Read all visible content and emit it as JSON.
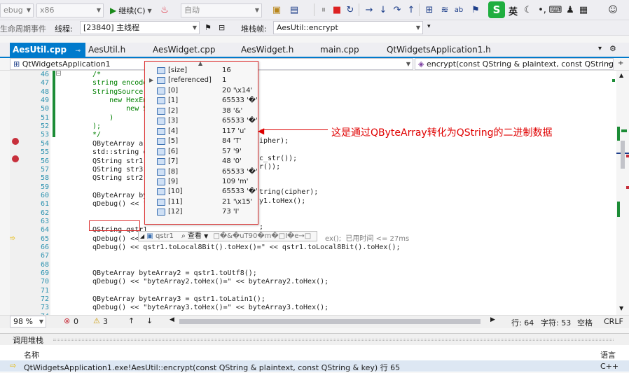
{
  "toolbar": {
    "config_combo": "ebug",
    "platform_combo": "x86",
    "continue_label": "继续(C)",
    "auto_combo": "自动",
    "ime_label": "英"
  },
  "toolbar2": {
    "lifecycle_label": "生命周期事件",
    "thread_label": "线程:",
    "thread_value": "[23840] 主线程",
    "stackframe_label": "堆栈帧:",
    "stackframe_value": "AesUtil::encrypt"
  },
  "tabs": [
    {
      "label": "AesUtil.cpp",
      "active": true
    },
    {
      "label": "AesUtil.h"
    },
    {
      "label": "AesWidget.cpp"
    },
    {
      "label": "AesWidget.h"
    },
    {
      "label": "main.cpp"
    },
    {
      "label": "QtWidgetsApplication1.h"
    }
  ],
  "navbar": {
    "project": "QtWidgetsApplication1",
    "function": "encrypt(const QString & plaintext, const QString"
  },
  "lines": [
    {
      "n": "46",
      "t": "/*"
    },
    {
      "n": "47",
      "t": "string encoded"
    },
    {
      "n": "48",
      "t": "StringSource(c"
    },
    {
      "n": "49",
      "t": "    new HexEnc"
    },
    {
      "n": "50",
      "t": "        new St"
    },
    {
      "n": "51",
      "t": "    )"
    },
    {
      "n": "52",
      "t": ");"
    },
    {
      "n": "53",
      "t": "*/"
    },
    {
      "n": "54",
      "t": "QByteArray ar"
    },
    {
      "n": "55",
      "t": "std::string ci"
    },
    {
      "n": "56",
      "t": "QString str1 ="
    },
    {
      "n": "57",
      "t": "QString str3 ="
    },
    {
      "n": "58",
      "t": "QString str2 ="
    },
    {
      "n": "59",
      "t": ""
    },
    {
      "n": "60",
      "t": "QByteArray byte"
    },
    {
      "n": "61",
      "t": "qDebug() << \"b"
    },
    {
      "n": "62",
      "t": ""
    },
    {
      "n": "63",
      "t": ""
    },
    {
      "n": "64",
      "t": "QString qstr1"
    },
    {
      "n": "65",
      "t": "qDebug() <<"
    },
    {
      "n": "66",
      "t": "qDebug() << qstr1.toLocal8Bit().toHex()=\" << qstr1.toLocal8Bit().toHex();"
    },
    {
      "n": "67",
      "t": ""
    },
    {
      "n": "68",
      "t": ""
    },
    {
      "n": "69",
      "t": "QByteArray byteArray2 = qstr1.toUtf8();"
    },
    {
      "n": "70",
      "t": "qDebug() << \"byteArray2.toHex()=\" << byteArray2.toHex();"
    },
    {
      "n": "71",
      "t": ""
    },
    {
      "n": "72",
      "t": "QByteArray byteArray3 = qstr1.toLatin1();"
    },
    {
      "n": "73",
      "t": "qDebug() << \"byteArray3.toHex()=\" << byteArray3.toHex();"
    },
    {
      "n": "74",
      "t": ""
    }
  ],
  "tails": {
    "l54": "ipher);",
    "l56": "c_str());",
    "l57": "r());",
    "l60": "tring(cipher);",
    "l61": "y1.toHex();",
    "l64": ";",
    "l65": "ex();  已用时间 <= 27ms"
  },
  "datatip": {
    "rows": [
      {
        "name": "[size]",
        "value": "16",
        "expand": false
      },
      {
        "name": "[referenced]",
        "value": "1",
        "expand": true
      },
      {
        "name": "[0]",
        "value": "20 '\\x14'"
      },
      {
        "name": "[1]",
        "value": "65533 '�'"
      },
      {
        "name": "[2]",
        "value": "38 '&'"
      },
      {
        "name": "[3]",
        "value": "65533 '�'"
      },
      {
        "name": "[4]",
        "value": "117 'u'"
      },
      {
        "name": "[5]",
        "value": "84 'T'"
      },
      {
        "name": "[6]",
        "value": "57 '9'"
      },
      {
        "name": "[7]",
        "value": "48 '0'"
      },
      {
        "name": "[8]",
        "value": "65533 '�'"
      },
      {
        "name": "[9]",
        "value": "109 'm'"
      },
      {
        "name": "[10]",
        "value": "65533 '�'"
      },
      {
        "name": "[11]",
        "value": "21 '\\x15'"
      },
      {
        "name": "[12]",
        "value": "73 'I'"
      }
    ],
    "var_name": "qstr1",
    "view_label": "查看",
    "preview": "□�&�uT90�m�□I�e→□"
  },
  "annotation": "这是通过QByteArray转化为QString的二进制数据",
  "status": {
    "zoom": "98 %",
    "errors": "0",
    "warnings": "3",
    "line": "行: 64",
    "char": "字符: 53",
    "whitespace": "空格",
    "eol": "CRLF"
  },
  "callstack": {
    "title": "调用堆栈",
    "col_name": "名称",
    "col_lang": "语言",
    "row_name": "QtWidgetsApplication1.exe!AesUtil::encrypt(const QString & plaintext, const QString & key) 行 65",
    "row_lang": "C++"
  }
}
